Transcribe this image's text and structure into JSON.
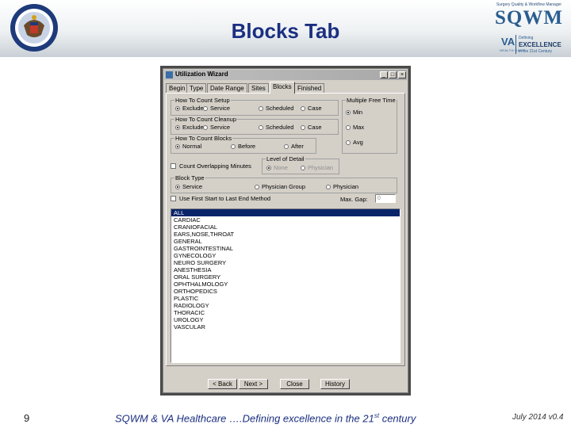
{
  "slide": {
    "title": "Blocks Tab",
    "page_number": "9",
    "footer_text_before": "SQWM & VA Healthcare ….Defining excellence in the 21",
    "footer_text_sup": "st",
    "footer_text_after": " century",
    "version": "July 2014 v0.4"
  },
  "logos": {
    "seal_icon": "federal-health-care-center-seal",
    "sqwm_tagline": "Surgery Quality & Workflow Manager",
    "sqwm_word": "SQWM",
    "va_mark": "VA",
    "va_sub": "HEALTH CARE",
    "va_defining": "Defining",
    "va_excellence": "EXCELLENCE",
    "va_century": "in the 21st Century"
  },
  "window": {
    "title": "Utilization Wizard",
    "btn_min": "_",
    "btn_max": "□",
    "btn_close": "×",
    "tabs": [
      "Begin",
      "Type",
      "Date Range",
      "Sites",
      "Blocks",
      "Finished"
    ],
    "active_tab": "Blocks",
    "count_setup": {
      "legend": "How To Count Setup",
      "options": [
        "Exclude",
        "Service",
        "Scheduled",
        "Case"
      ],
      "selected": "Exclude"
    },
    "count_cleanup": {
      "legend": "How To Count Cleanup",
      "options": [
        "Exclude",
        "Service",
        "Scheduled",
        "Case"
      ],
      "selected": "Exclude"
    },
    "count_blocks": {
      "legend": "How To Count Blocks",
      "options": [
        "Normal",
        "Before",
        "After"
      ],
      "selected": "Normal"
    },
    "multiple_free_time": {
      "legend": "Multiple Free Time",
      "options": [
        "Min",
        "Max",
        "Avg"
      ],
      "selected": "Min"
    },
    "count_overlapping": {
      "label": "Count Overlapping Minutes",
      "checked": false
    },
    "level_of_detail": {
      "legend": "Level of Detail",
      "options": [
        "None",
        "Physician"
      ],
      "selected": "None",
      "disabled": true
    },
    "block_type": {
      "legend": "Block Type",
      "options": [
        "Service",
        "Physician Group",
        "Physician"
      ],
      "selected": "Service"
    },
    "first_start_last_end": {
      "label": "Use First Start to Last End Method",
      "checked": false
    },
    "max_gap": {
      "label": "Max. Gap:",
      "value": "0"
    },
    "services": [
      "ALL",
      "CARDIAC",
      "CRANIOFACIAL",
      "EARS,NOSE,THROAT",
      "GENERAL",
      "GASTROINTESTINAL",
      "GYNECOLOGY",
      "NEURO SURGERY",
      "ANESTHESIA",
      "ORAL SURGERY",
      "OPHTHALMOLOGY",
      "ORTHOPEDICS",
      "PLASTIC",
      "RADIOLOGY",
      "THORACIC",
      "UROLOGY",
      "VASCULAR"
    ],
    "selected_service": "ALL",
    "buttons": {
      "back": "< Back",
      "next": "Next >",
      "close": "Close",
      "history": "History"
    }
  }
}
